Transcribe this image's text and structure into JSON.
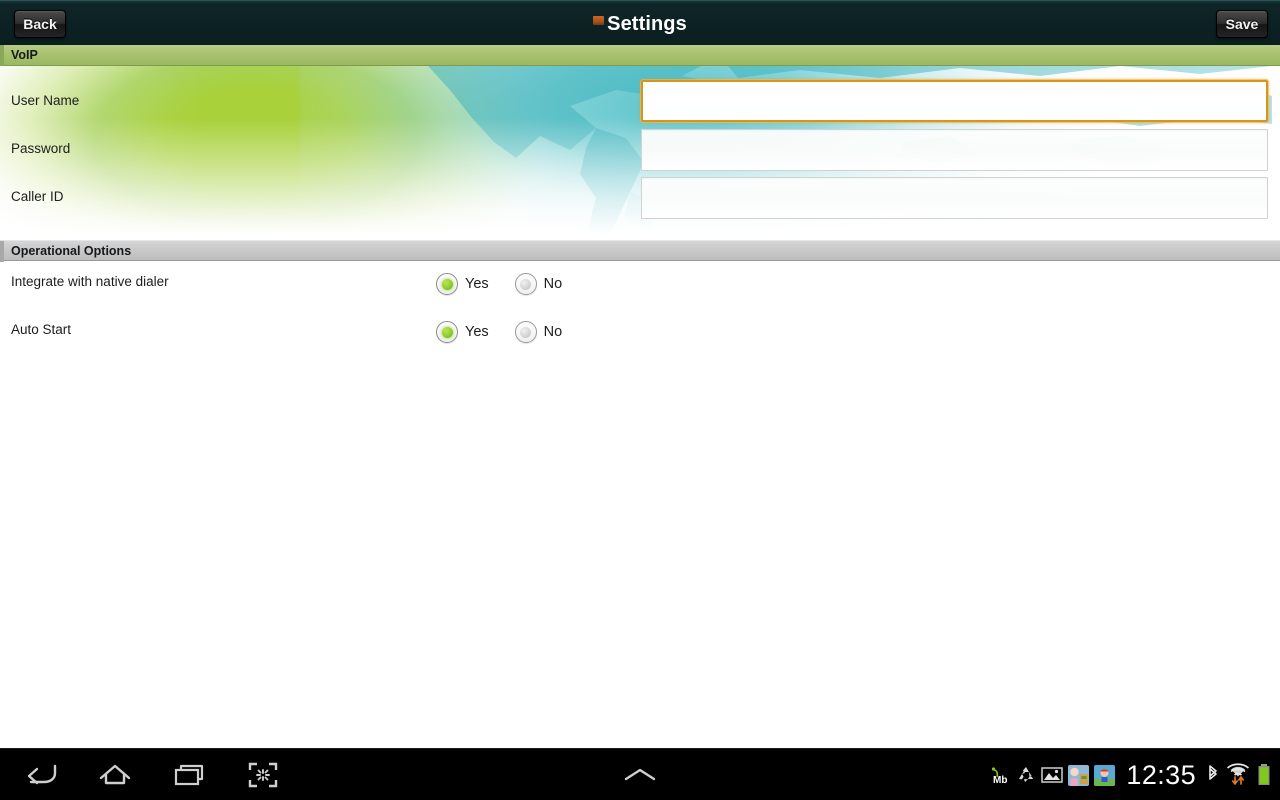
{
  "titlebar": {
    "back_label": "Back",
    "title": "Settings",
    "save_label": "Save",
    "app_icon": "app-icon",
    "bg_color": "#0b1e20"
  },
  "sections": [
    {
      "id": "voip",
      "header": "VoIP",
      "header_color": "#a2bd69",
      "fields": [
        {
          "label": "User Name",
          "value": "",
          "placeholder": "",
          "focused": true,
          "type": "text"
        },
        {
          "label": "Password",
          "value": "",
          "placeholder": "",
          "focused": false,
          "type": "password"
        },
        {
          "label": "Caller ID",
          "value": "",
          "placeholder": "",
          "focused": false,
          "type": "text"
        }
      ]
    },
    {
      "id": "operational-options",
      "header": "Operational Options",
      "header_color": "#c2c2c2",
      "options": [
        {
          "label": "Integrate with native dialer",
          "selected": "Yes",
          "choices": [
            {
              "label": "Yes",
              "selected": true
            },
            {
              "label": "No",
              "selected": false
            }
          ]
        },
        {
          "label": "Auto Start",
          "selected": "Yes",
          "choices": [
            {
              "label": "Yes",
              "selected": true
            },
            {
              "label": "No",
              "selected": false
            }
          ]
        }
      ]
    }
  ],
  "accent": {
    "focus_border": "#d8941f",
    "radio_on": "#8fcc2a",
    "radio_off": "#d6d6d6"
  },
  "navbar": {
    "buttons": [
      {
        "name": "back-icon",
        "label": "Back"
      },
      {
        "name": "home-icon",
        "label": "Home"
      },
      {
        "name": "recents-icon",
        "label": "Recent apps"
      },
      {
        "name": "screenshot-icon",
        "label": "Screenshot"
      }
    ],
    "center": {
      "name": "chevron-up-icon",
      "label": "Notifications"
    },
    "status": {
      "notifications": [
        {
          "name": "data-usage-mb-icon",
          "label": "Mb"
        },
        {
          "name": "recycle-icon",
          "label": "Recycle"
        },
        {
          "name": "gallery-image-icon",
          "label": "Gallery"
        },
        {
          "name": "app-thumbnail-icon",
          "label": "App"
        },
        {
          "name": "app-thumbnail-2-icon",
          "label": "App"
        }
      ],
      "clock": "12:35",
      "bluetooth": {
        "name": "bluetooth-icon",
        "label": "Bluetooth"
      },
      "wifi": {
        "name": "wifi-icon",
        "label": "Wi-Fi"
      },
      "battery": {
        "name": "battery-icon",
        "label": "Battery",
        "color": "#7ec820"
      }
    }
  }
}
